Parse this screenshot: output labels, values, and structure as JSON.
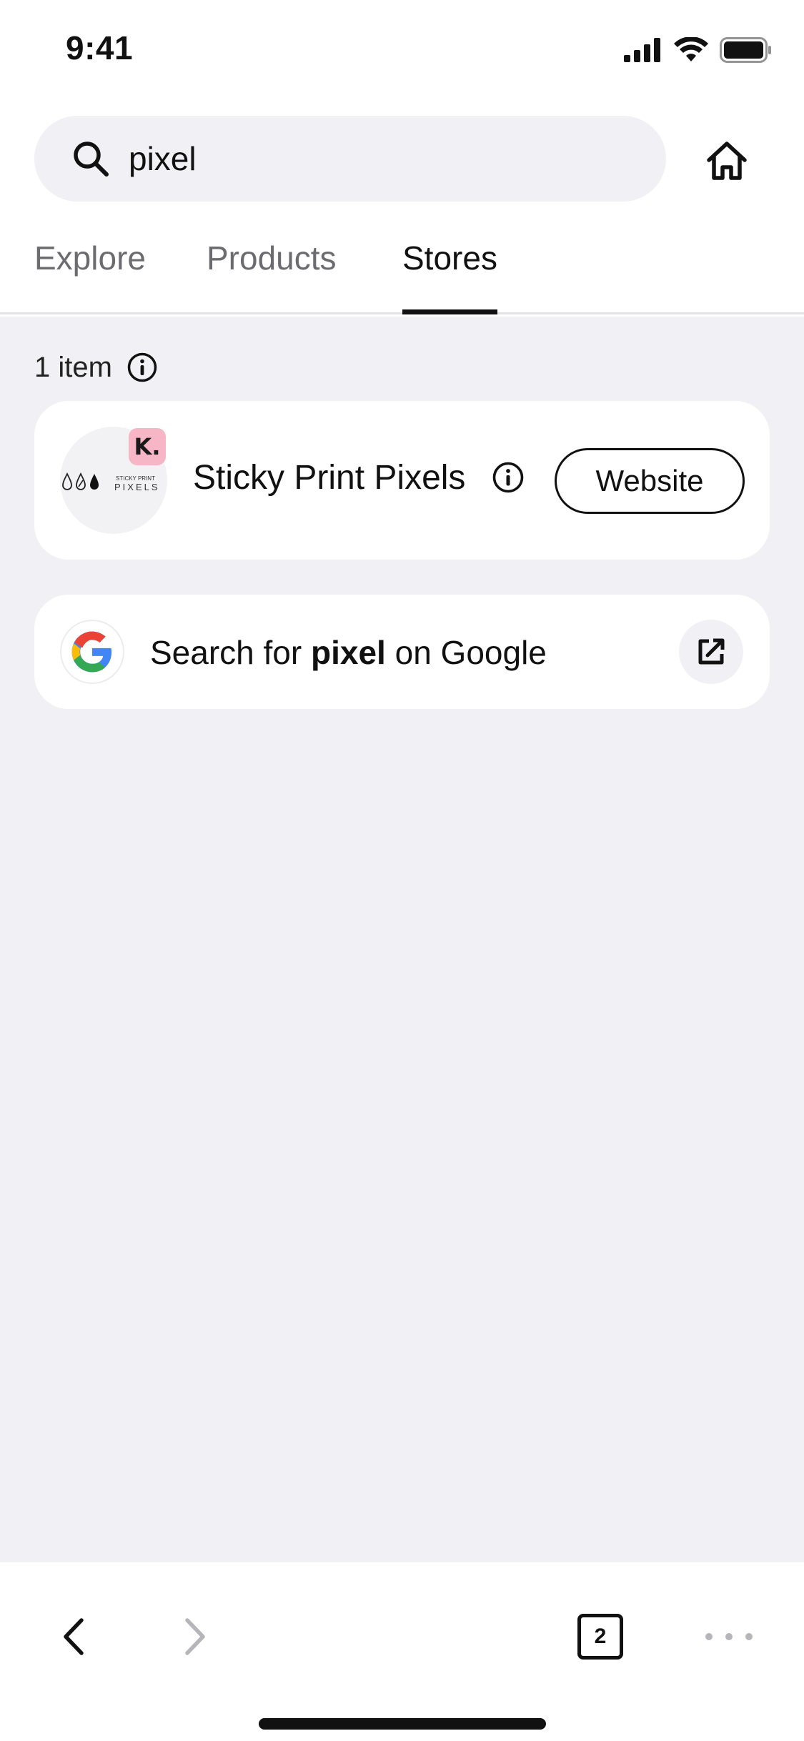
{
  "status_bar": {
    "time": "9:41"
  },
  "search": {
    "query": "pixel"
  },
  "tabs": [
    {
      "label": "Explore",
      "active": false
    },
    {
      "label": "Products",
      "active": false
    },
    {
      "label": "Stores",
      "active": true
    }
  ],
  "results": {
    "count_label": "1 item",
    "store": {
      "name": "Sticky Print Pixels",
      "logo_text_top": "STICKY PRINT",
      "logo_text_bottom": "PIXELS",
      "badge": "K.",
      "website_label": "Website"
    },
    "google": {
      "prefix": "Search for ",
      "term": "pixel",
      "suffix": " on Google"
    }
  },
  "toolbar": {
    "tab_count": "2"
  },
  "colors": {
    "background": "#f1f1f5",
    "card": "#ffffff",
    "klarna_badge": "#f7b6c6",
    "google_blue": "#4285F4",
    "google_red": "#EA4335",
    "google_yellow": "#FBBC05",
    "google_green": "#34A853"
  }
}
